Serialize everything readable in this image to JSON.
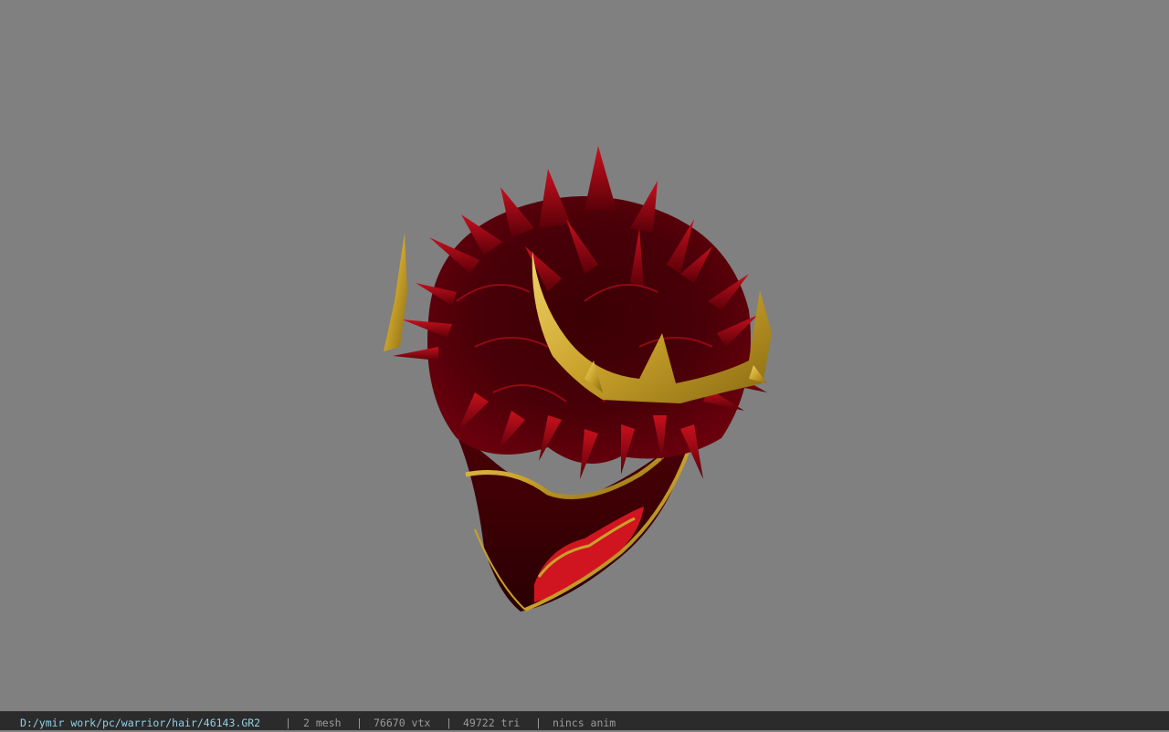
{
  "viewer": {
    "background_color": "#808080",
    "model_name": "46143.GR2"
  },
  "status_bar": {
    "file_path": "D:/ymir work/pc/warrior/hair/46143.GR2",
    "separator": "|",
    "mesh_count": "2 mesh",
    "vertex_count": "76670 vtx",
    "triangle_count": "49722 tri",
    "animation_status": "nincs anim",
    "path_color": "#8fd0e8",
    "text_color": "#9a9a9a"
  }
}
